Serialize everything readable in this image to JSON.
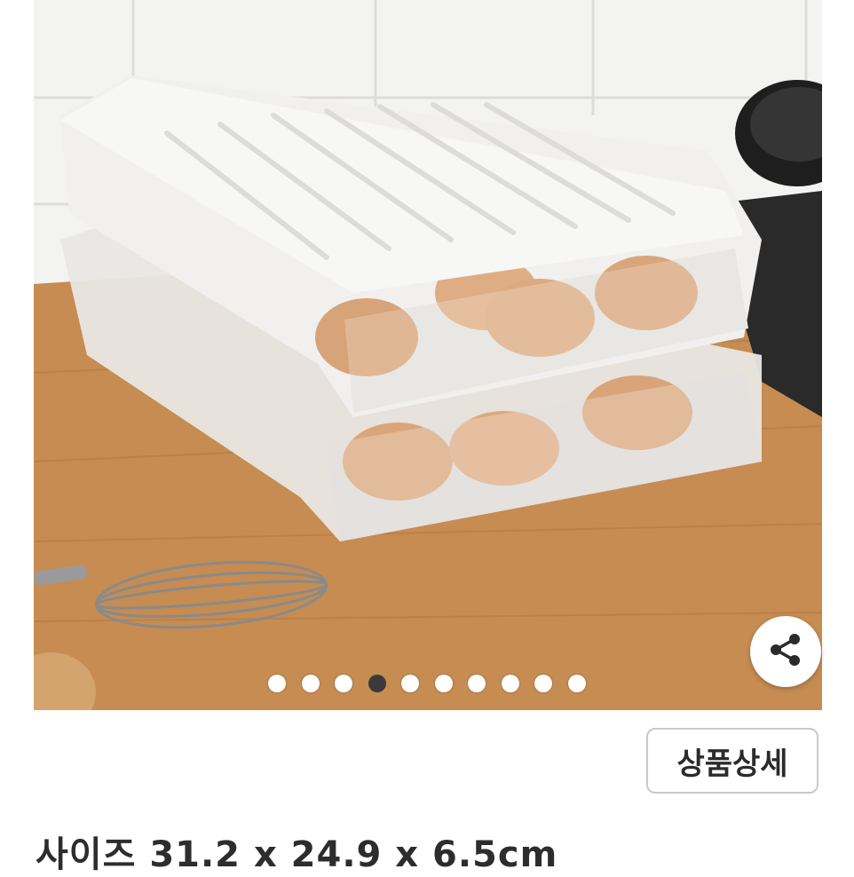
{
  "gallery": {
    "image_alt": "",
    "slide_count": 10,
    "active_index": 3,
    "share_icon": "share-icon"
  },
  "actions": {
    "detail_label": "상품상세"
  },
  "product": {
    "size_text": "사이즈 31.2 x 24.9 x 6.5cm"
  }
}
